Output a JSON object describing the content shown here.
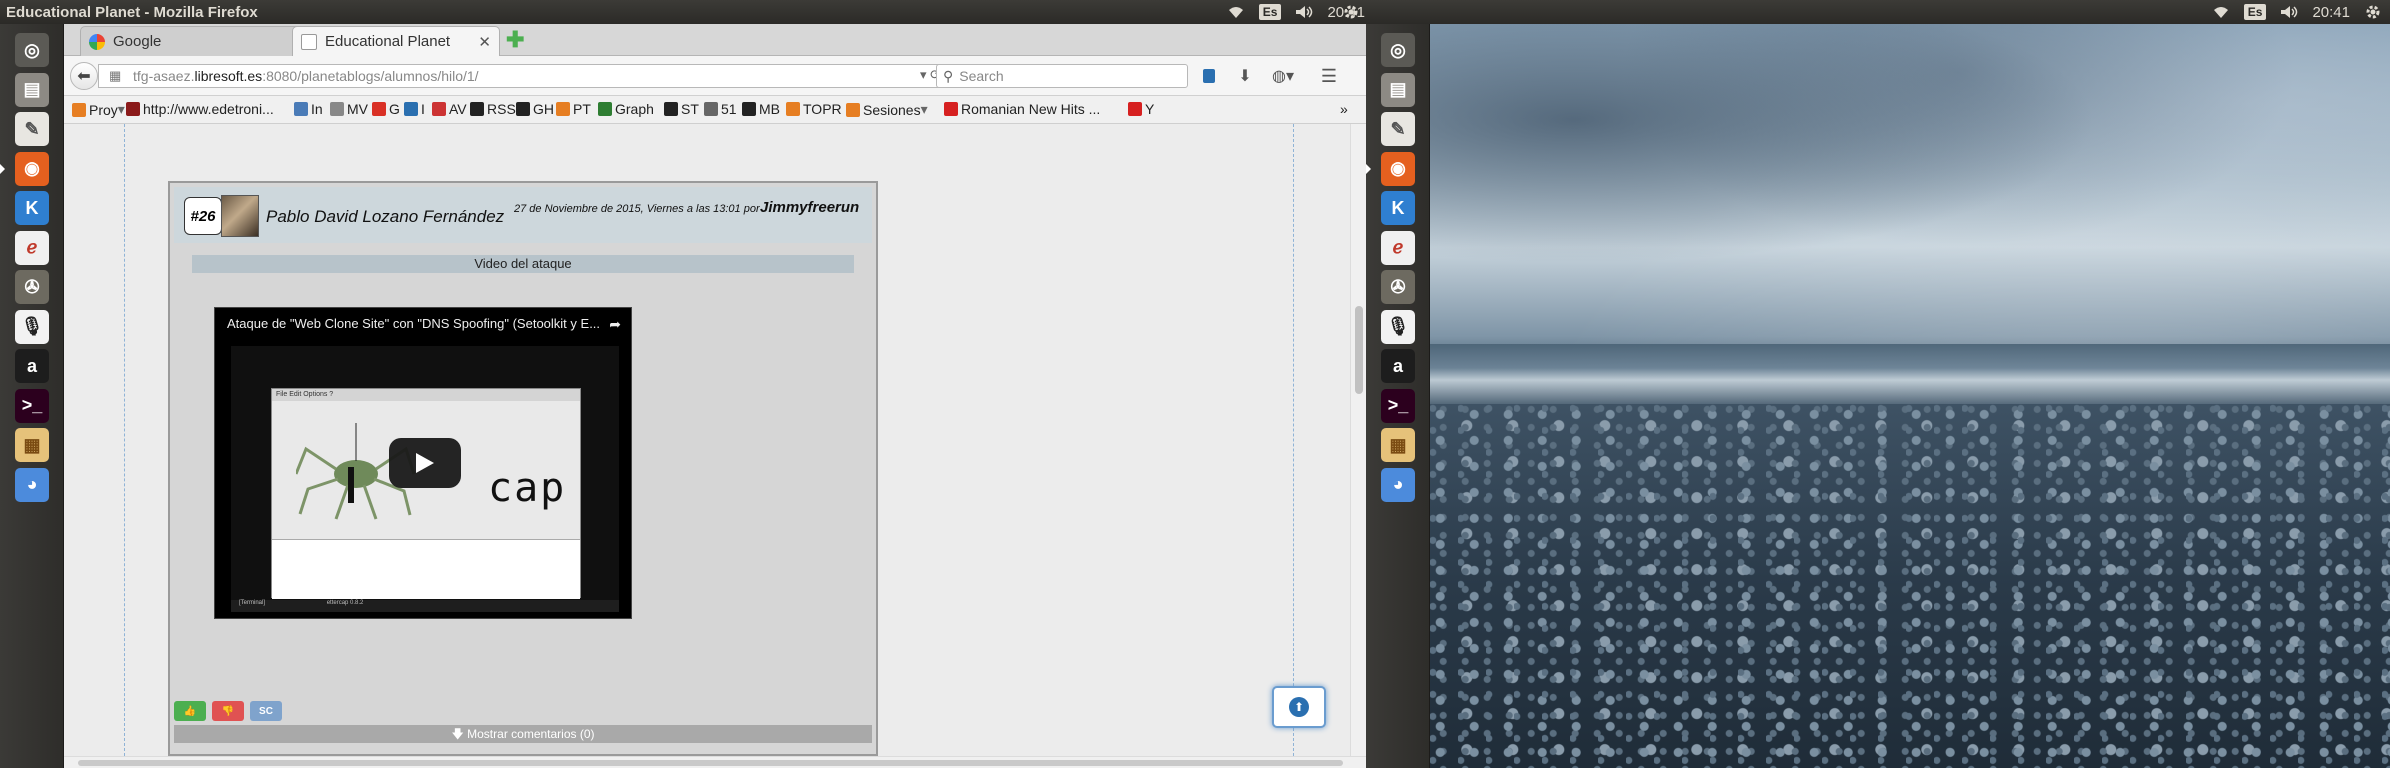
{
  "top_panel": {
    "window_title": "Educational Planet - Mozilla Firefox",
    "keyboard_layout": "Es",
    "time": "20:41"
  },
  "launcher": {
    "items": [
      "dash-icon",
      "files-icon",
      "text-editor-icon",
      "firefox-icon",
      "kde-connect-icon",
      "evince-icon",
      "gimp-icon",
      "audio-recorder-icon",
      "amazon-icon",
      "terminal-icon",
      "impress-icon",
      "chromium-icon"
    ]
  },
  "browser": {
    "tabs": [
      {
        "label": "Google",
        "active": false
      },
      {
        "label": "Educational Planet",
        "active": true
      }
    ],
    "url": {
      "prefix": "tfg-asaez.",
      "host": "libresoft.es",
      "rest": ":8080/planetablogs/alumnos/hilo/1/"
    },
    "search_placeholder": "Search",
    "bookmarks": [
      {
        "label": "Proy",
        "color": "#e67e22",
        "dropdown": true
      },
      {
        "label": "http://www.edetroni...",
        "color": "#8b1a1a"
      },
      {
        "label": "In",
        "color": "#4a7bb7"
      },
      {
        "label": "MV",
        "color": "#888888"
      },
      {
        "label": "G",
        "color": "#d93025"
      },
      {
        "label": "I",
        "color": "#2a6fb0"
      },
      {
        "label": "AV",
        "color": "#cc3333"
      },
      {
        "label": "RSS",
        "color": "#222222"
      },
      {
        "label": "GH",
        "color": "#222222"
      },
      {
        "label": "PT",
        "color": "#e67e22"
      },
      {
        "label": "Graph",
        "color": "#2e7d32"
      },
      {
        "label": "ST",
        "color": "#222222"
      },
      {
        "label": "51",
        "color": "#666666"
      },
      {
        "label": "MB",
        "color": "#222222"
      },
      {
        "label": "TOPR",
        "color": "#e67e22"
      },
      {
        "label": "Sesiones",
        "color": "#e67e22",
        "dropdown": true
      },
      {
        "label": "Romanian New Hits ...",
        "color": "#d62020"
      },
      {
        "label": "Y",
        "color": "#d62020"
      }
    ],
    "overflow": "»"
  },
  "post": {
    "number": "#26",
    "author": "Pablo David Lozano Fernández",
    "date": "27 de Noviembre de 2015, Viernes a las 13:01 por",
    "username": "Jimmyfreerun",
    "title": "Video del ataque",
    "video": {
      "title": "Ataque de \"Web Clone Site\" con \"DNS Spoofing\" (Setoolkit y E...",
      "app_menu": "File  Edit  Options  ?",
      "app_text": "cap",
      "taskbar_left": "[Terminal]",
      "taskbar_mid": "ettercap 0.8.2"
    },
    "share_buttons": [
      "like",
      "dislike",
      "SC"
    ],
    "comments_label": "Mostrar comentarios (0)"
  },
  "colors": {
    "panel": "#2b2a27",
    "post_header": "#cdd7dc",
    "accent_blue": "#2a6fb0"
  }
}
